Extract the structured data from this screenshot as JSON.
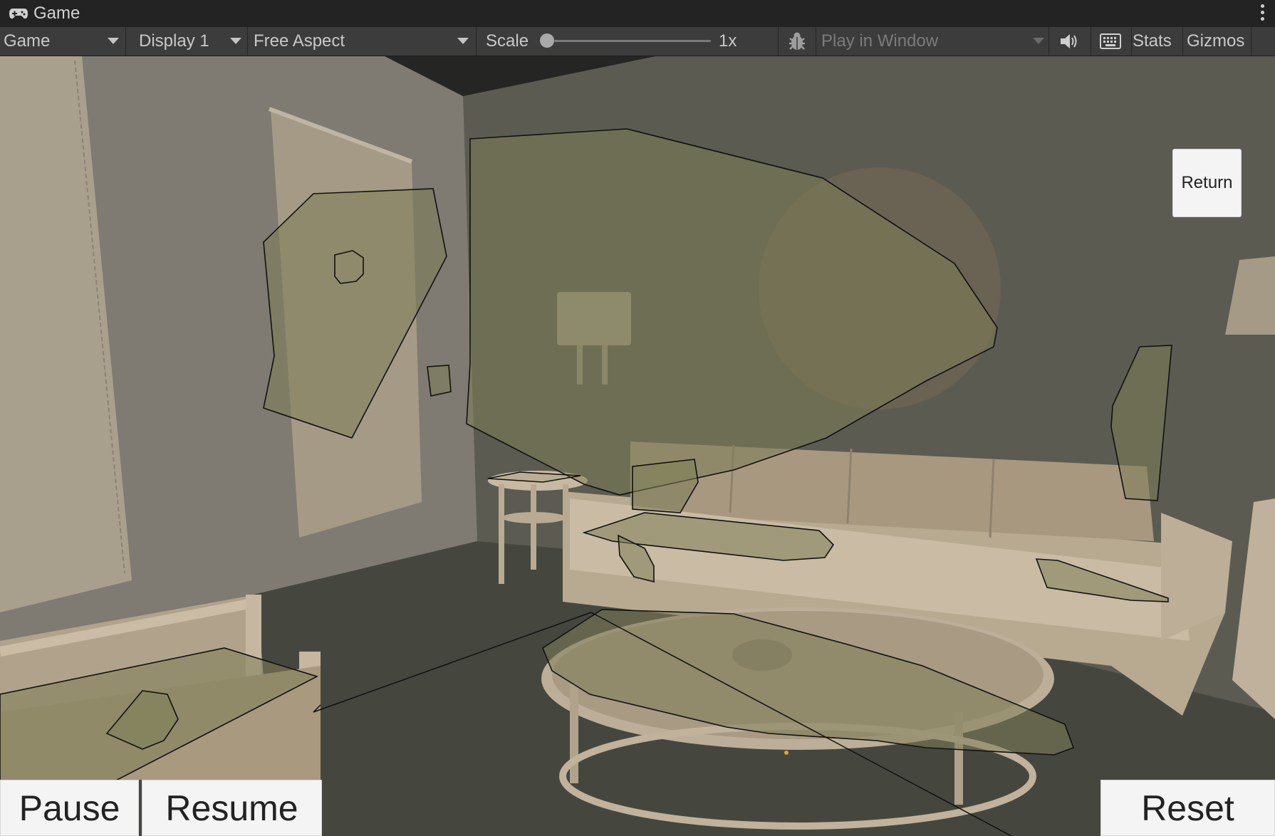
{
  "window": {
    "tab_title": "Game",
    "tab_icon": "gamepad-icon",
    "menu_icon": "kebab-menu-icon"
  },
  "toolbar": {
    "view_dropdown": "Game",
    "display_dropdown": "Display 1",
    "aspect_dropdown": "Free Aspect",
    "scale_label": "Scale",
    "scale_value": "1x",
    "scale_slider_level": 0,
    "debug_icon": "bug-icon",
    "play_mode_dropdown": "Play in Window",
    "audio_icon": "speaker-icon",
    "keyboard_icon": "keyboard-icon",
    "stats_label": "Stats",
    "gizmos_label": "Gizmos",
    "gizmos_menu_icon": "chevron-down-icon"
  },
  "game_ui": {
    "return_label": "Return",
    "pause_label": "Pause",
    "resume_label": "Resume",
    "reset_label": "Reset"
  },
  "colors": {
    "editor_titlebar": "#232323",
    "editor_toolbar": "#3c3c3c",
    "toolbar_text": "#c8c8c8",
    "room_wall": "#6f6c63",
    "room_floor": "#3f433a",
    "furniture": "#c8b9a2",
    "overlay_fill": "#7d7e58",
    "button_bg": "#f4f4f4"
  }
}
